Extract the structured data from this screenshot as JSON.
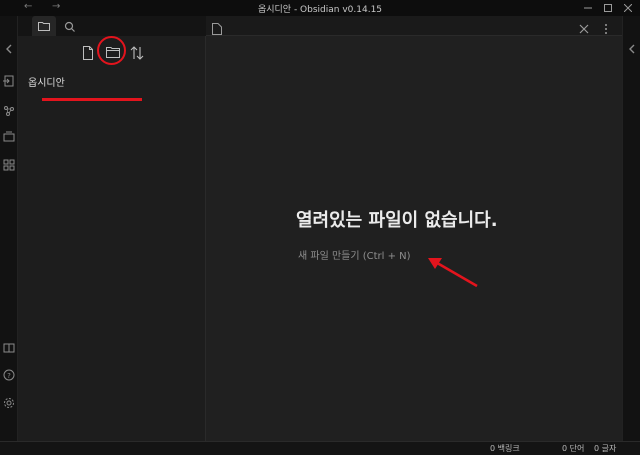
{
  "window": {
    "title": "옵시디안 - Obsidian v0.14.15",
    "back_glyph": "←",
    "forward_glyph": "→"
  },
  "sidebar": {
    "tabs": [
      {
        "icon": "folder-icon",
        "active": true
      },
      {
        "icon": "search-icon",
        "active": false
      }
    ],
    "actions": [
      {
        "icon": "new-note-icon"
      },
      {
        "icon": "new-folder-icon"
      },
      {
        "icon": "sort-icon"
      }
    ],
    "vault_name": "옵시디안"
  },
  "ribbon": {
    "left_icons": [
      "collapse-left-icon",
      "open-quick-switcher-icon",
      "graph-view-icon",
      "command-palette-icon",
      "templates-icon",
      "open-vault-icon",
      "help-icon",
      "settings-icon"
    ],
    "right_icons": [
      "collapse-right-icon"
    ]
  },
  "main": {
    "header_icons": [
      "file-icon",
      "close-icon",
      "more-options-icon"
    ],
    "empty_title": "열려있는 파일이 없습니다.",
    "create_link": "새 파일 만들기 (Ctrl + N)"
  },
  "status": {
    "backlinks": "0 백링크",
    "words": "0 단어",
    "chars": "0 글자"
  },
  "colors": {
    "annotation": "#e3141d",
    "background": "#202020",
    "sidebar": "#1d1d1d"
  }
}
